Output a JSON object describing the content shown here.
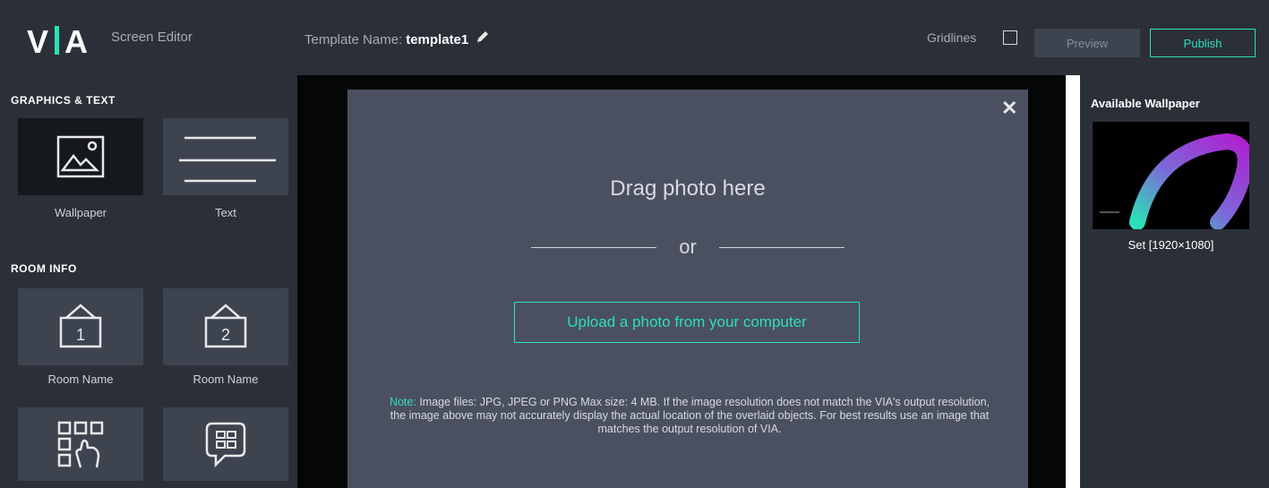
{
  "header": {
    "logo": "VIA",
    "app_title": "Screen Editor",
    "template_label": "Template Name:",
    "template_name": "template1",
    "gridlines_label": "Gridlines",
    "preview_label": "Preview",
    "publish_label": "Publish"
  },
  "sidebar": {
    "section_graphics": "GRAPHICS & TEXT",
    "graphics_items": [
      {
        "label": "Wallpaper",
        "icon": "image-icon"
      },
      {
        "label": "Text",
        "icon": "text-lines-icon"
      }
    ],
    "section_room": "ROOM INFO",
    "room_items": [
      {
        "label": "Room Name",
        "icon": "room-sign-1-icon",
        "number": "1"
      },
      {
        "label": "Room Name",
        "icon": "room-sign-2-icon",
        "number": "2"
      },
      {
        "label": "",
        "icon": "qr-touch-icon"
      },
      {
        "label": "",
        "icon": "chat-grid-icon"
      }
    ]
  },
  "dialog": {
    "drag_text": "Drag photo here",
    "or_text": "or",
    "upload_label": "Upload a photo from your computer",
    "note_label": "Note:",
    "note_text": "Image files: JPG, JPEG or PNG Max size: 4 MB. If the image resolution does not match the VIA's output resolution, the image above may not accurately display the actual location of the overlaid objects. For best results use an image that matches the output resolution of VIA."
  },
  "wallpaper_panel": {
    "title": "Available Wallpaper",
    "thumb_label": "Set [1920×1080]"
  },
  "colors": {
    "accent": "#2ce0b7",
    "topbar": "#2b3038",
    "dialog": "#4a5060"
  }
}
